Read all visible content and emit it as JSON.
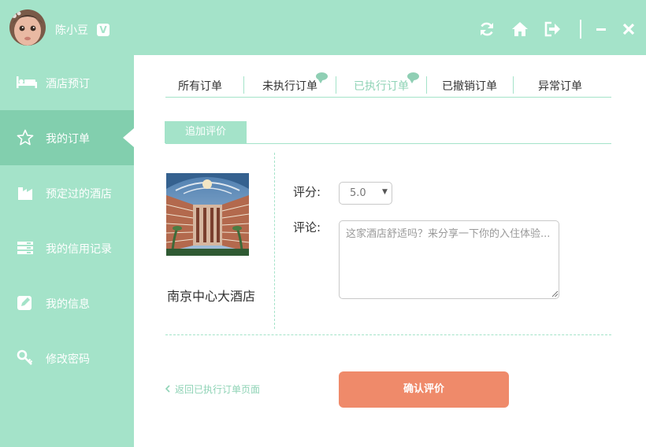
{
  "user": {
    "name": "陈小豆",
    "vip_badge": "V",
    "avatar_icon": "avatar"
  },
  "titlebar": {
    "icons": [
      "refresh-icon",
      "home-icon",
      "logout-icon",
      "minimize-icon",
      "close-icon"
    ]
  },
  "sidebar": {
    "items": [
      {
        "label": "酒店预订",
        "icon": "bed-icon",
        "active": false
      },
      {
        "label": "我的订单",
        "icon": "star-icon",
        "active": true
      },
      {
        "label": "预定过的酒店",
        "icon": "building-icon",
        "active": false
      },
      {
        "label": "我的信用记录",
        "icon": "list-icon",
        "active": false
      },
      {
        "label": "我的信息",
        "icon": "edit-icon",
        "active": false
      },
      {
        "label": "修改密码",
        "icon": "key-icon",
        "active": false
      }
    ]
  },
  "tabs": [
    {
      "label": "所有订单",
      "active": false,
      "has_badge": false
    },
    {
      "label": "未执行订单",
      "active": false,
      "has_badge": true
    },
    {
      "label": "已执行订单",
      "active": true,
      "has_badge": true
    },
    {
      "label": "已撤销订单",
      "active": false,
      "has_badge": false
    },
    {
      "label": "异常订单",
      "active": false,
      "has_badge": false
    }
  ],
  "subtab": {
    "label": "追加评价"
  },
  "hotel": {
    "name": "南京中心大酒店",
    "image_icon": "hotel-photo"
  },
  "form": {
    "rating_label": "评分:",
    "rating_value": "5.0",
    "comment_label": "评论:",
    "comment_placeholder": "这家酒店舒适吗？来分享一下你的入住体验...",
    "comment_value": ""
  },
  "actions": {
    "back_label": "返回已执行订单页面",
    "confirm_label": "确认评价"
  },
  "colors": {
    "mint": "#a4e3c9",
    "mint_active": "#82cfae",
    "accent_text": "#8fd3b6",
    "confirm_button": "#ef8a6a"
  }
}
